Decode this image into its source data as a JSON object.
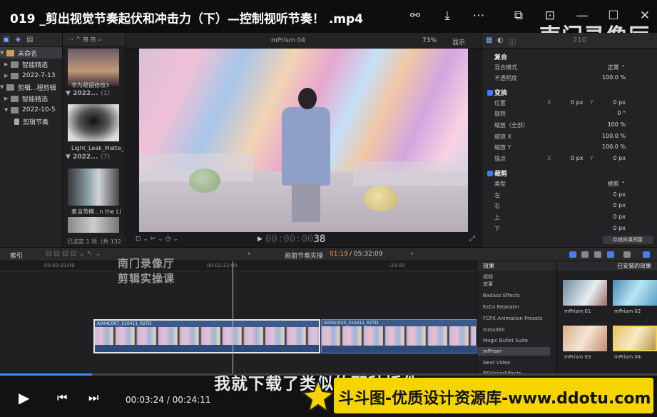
{
  "player": {
    "title": "019 _剪出视觉节奏起伏和冲击力（下）—控制视听节奏！ .mp4",
    "current_time": "00:03:24",
    "total_time": "00:24:11",
    "time_separator": "/",
    "progress": 0.14,
    "watermark_top": "南门录像厅",
    "subtitle": "我就下载了类似的那种插件",
    "banner": "斗斗图-优质设计资源库-www.ddotu.com"
  },
  "library": {
    "items": [
      {
        "label": "未命名",
        "selected": true
      },
      {
        "label": "智能精选",
        "selected": false
      },
      {
        "label": "2022-7-13",
        "selected": false
      },
      {
        "label": "剪辑...程剪辑",
        "selected": false
      },
      {
        "label": "智能精选",
        "selected": false
      },
      {
        "label": "2022-10-5",
        "selected": false
      },
      {
        "label": "剪辑节奏",
        "selected": false
      }
    ]
  },
  "browser": {
    "thumbs": [
      {
        "label": "华为眼镜修改3"
      },
      {
        "label": "Light_Leak_Matte_"
      },
      {
        "label": "麦当劳模...n the Li"
      }
    ],
    "groups": [
      {
        "label": "2022...",
        "count": "(1)"
      },
      {
        "label": "2022...",
        "count": "(7)"
      }
    ],
    "footer": "已选定 1 项（共 132 项）"
  },
  "viewer": {
    "clip_name": "mPrism 04",
    "zoom": "73%",
    "display": "显示",
    "timecode_dim": "00:00:00",
    "timecode_frames": "38"
  },
  "inspector": {
    "sections": {
      "composite": "复合",
      "transform": "变换",
      "crop": "裁剪"
    },
    "rows": {
      "blend_mode": {
        "label": "混合模式",
        "value": "正常 ⌃"
      },
      "opacity": {
        "label": "不透明度",
        "value": "100.0 %"
      },
      "position": {
        "label": "位置",
        "x_label": "X",
        "x": "0 px",
        "y_label": "Y",
        "y": "0 px"
      },
      "rotation": {
        "label": "旋转",
        "value": "0 °"
      },
      "scale_all": {
        "label": "缩放（全部）",
        "value": "100 %"
      },
      "scale_x": {
        "label": "缩放 X",
        "value": "100.0 %"
      },
      "scale_y": {
        "label": "缩放 Y",
        "value": "100.0 %"
      },
      "anchor": {
        "label": "锚点",
        "x_label": "X",
        "x": "0 px",
        "y_label": "Y",
        "y": "0 px"
      },
      "type": {
        "label": "类型",
        "value": "修剪 ⌃"
      },
      "left": {
        "label": "左",
        "value": "0 px"
      },
      "right": {
        "label": "右",
        "value": "0 px"
      },
      "top": {
        "label": "上",
        "value": "0 px"
      },
      "bottom": {
        "label": "下",
        "value": "0 px"
      }
    },
    "save_button": "存储效果预置",
    "header_code": "210"
  },
  "timeline_bar": {
    "index": "索引",
    "project": "画面节奏实操",
    "time": "01:19",
    "duration": "/ 05:32:09"
  },
  "timeline": {
    "ruler": [
      "00:02:31:00",
      "00:02:32:00",
      ":33:00"
    ],
    "watermark_line1": "南门录像厅",
    "watermark_line2": "剪辑实操课",
    "clips": [
      {
        "label": "A004C007_210411_R2TD",
        "selected": true
      },
      {
        "label": "A005C033_210411_R2TD",
        "selected": false
      }
    ]
  },
  "effects": {
    "header": "效果",
    "installed_header": "已安装的效果",
    "categories": [
      "视频",
      "遮罩",
      "BadAss Effects",
      "EzCo Repeater",
      "FCPX Animation Presets",
      "Insta360",
      "Magic Bullet Suite",
      "mPrism",
      "Neat Video",
      "REVisionEffects"
    ],
    "selected_category": "mPrism",
    "items": [
      {
        "name": "mPrism 01"
      },
      {
        "name": "mPrism 02"
      },
      {
        "name": "mPrism 03"
      },
      {
        "name": "mPrism 04"
      }
    ]
  },
  "colors": {
    "accent_blue": "#3d8ef5",
    "timecode_orange": "#e8a13a",
    "banner_yellow": "#f5d400"
  }
}
